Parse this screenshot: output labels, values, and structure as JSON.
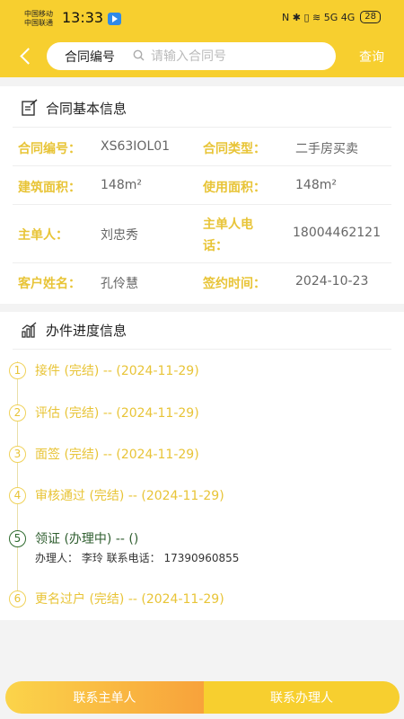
{
  "status_bar": {
    "carrier1": "中国移动",
    "carrier2": "中国联通",
    "time": "13:33",
    "icons": "N ✱ ▯ ≋ 5G 4G",
    "battery": "28"
  },
  "header": {
    "search_label": "合同编号",
    "search_placeholder": "请输入合同号",
    "query_label": "查询"
  },
  "contract": {
    "title": "合同基本信息",
    "fields": {
      "number_label": "合同编号：",
      "number_value": "XS63IOL01",
      "type_label": "合同类型：",
      "type_value": "二手房买卖",
      "build_area_label": "建筑面积：",
      "build_area_value": "148m²",
      "use_area_label": "使用面积：",
      "use_area_value": "148m²",
      "owner_label": "主单人：",
      "owner_value": "刘忠秀",
      "owner_phone_label_1": "主单人电",
      "owner_phone_label_2": "话：",
      "owner_phone_value": "18004462121",
      "customer_label": "客户姓名：",
      "customer_value": "孔伶慧",
      "sign_date_label": "签约时间：",
      "sign_date_value": "2024-10-23"
    }
  },
  "progress": {
    "title": "办件进度信息",
    "steps": [
      {
        "num": "1",
        "text": "接件 (完结) -- (2024-11-29)"
      },
      {
        "num": "2",
        "text": "评估 (完结) -- (2024-11-29)"
      },
      {
        "num": "3",
        "text": "面签 (完结) -- (2024-11-29)"
      },
      {
        "num": "4",
        "text": "审核通过 (完结) -- (2024-11-29)"
      },
      {
        "num": "5",
        "text": "领证 (办理中) -- ()"
      },
      {
        "num": "6",
        "text": "更名过户 (完结) -- (2024-11-29)"
      }
    ],
    "step5_detail": "办理人：  李玲  联系电话：  17390960855"
  },
  "actions": {
    "contact_owner": "联系主单人",
    "contact_handler": "联系办理人"
  },
  "colors": {
    "brand_yellow": "#f7cf2f",
    "label_gold": "#e8c437",
    "active_green": "#2f6b2f",
    "gradient_orange": "#f8a23b"
  }
}
